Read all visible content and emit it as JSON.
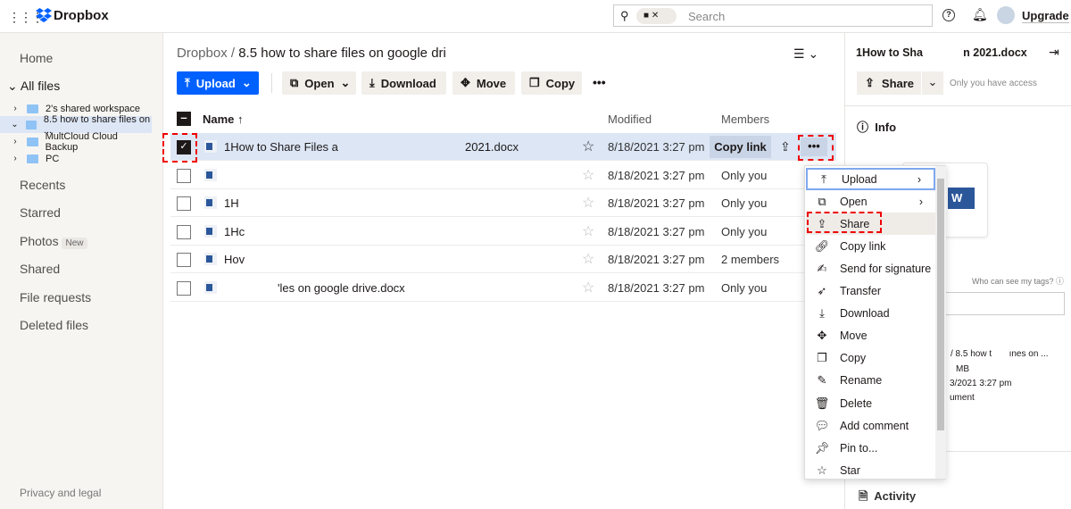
{
  "header": {
    "brand": "Dropbox",
    "search_placeholder": "Search",
    "upgrade": "Upgrade"
  },
  "sidebar": {
    "home": "Home",
    "all_files": "All files",
    "tree": [
      "2's shared workspace",
      "8.5 how to share files on ...",
      "MultCloud Cloud Backup",
      "PC"
    ],
    "items": [
      "Recents",
      "Starred",
      "Photos",
      "Shared",
      "File requests",
      "Deleted files"
    ],
    "photos_badge": "New",
    "footer": "Privacy and legal"
  },
  "main": {
    "breadcrumb_root": "Dropbox",
    "breadcrumb_sep": "/",
    "breadcrumb_current": "8.5 how to share files on google dri",
    "toolbar": {
      "upload": "Upload",
      "open": "Open",
      "download": "Download",
      "move": "Move",
      "copy": "Copy"
    },
    "columns": {
      "name": "Name",
      "modified": "Modified",
      "members": "Members"
    },
    "copy_link": "Copy link",
    "rows": [
      {
        "name": "1How to Share Files a",
        "name_end": "2021.docx",
        "modified": "8/18/2021 3:27 pm",
        "members": "",
        "selected": true
      },
      {
        "name": "",
        "name_end": "",
        "modified": "8/18/2021 3:27 pm",
        "members": "Only you"
      },
      {
        "name": "1H",
        "name_end": "",
        "modified": "8/18/2021 3:27 pm",
        "members": "Only you"
      },
      {
        "name": "1Hc",
        "name_end": "",
        "modified": "8/18/2021 3:27 pm",
        "members": "Only you"
      },
      {
        "name": "Hov",
        "name_end": "",
        "modified": "8/18/2021 3:27 pm",
        "members": "2 members"
      },
      {
        "name": "",
        "name_end": "'les on google drive.docx",
        "modified": "8/18/2021 3:27 pm",
        "members": "Only you"
      }
    ]
  },
  "menu": [
    "Upload",
    "Open",
    "Share",
    "Copy link",
    "Send for signature",
    "Transfer",
    "Download",
    "Move",
    "Copy",
    "Rename",
    "Delete",
    "Add comment",
    "Pin to...",
    "Star"
  ],
  "panel": {
    "title": "1How to Sha",
    "title_end": "n 2021.docx",
    "share": "Share",
    "access": "Only you have access",
    "info": "Info",
    "tags_help": "Who can see my tags?",
    "path": "/  8.5 how t",
    "path_end": "ınes on ...",
    "size": "MB",
    "modified": "3/2021 3:27 pm",
    "type": "ument",
    "activity": "Activity"
  }
}
